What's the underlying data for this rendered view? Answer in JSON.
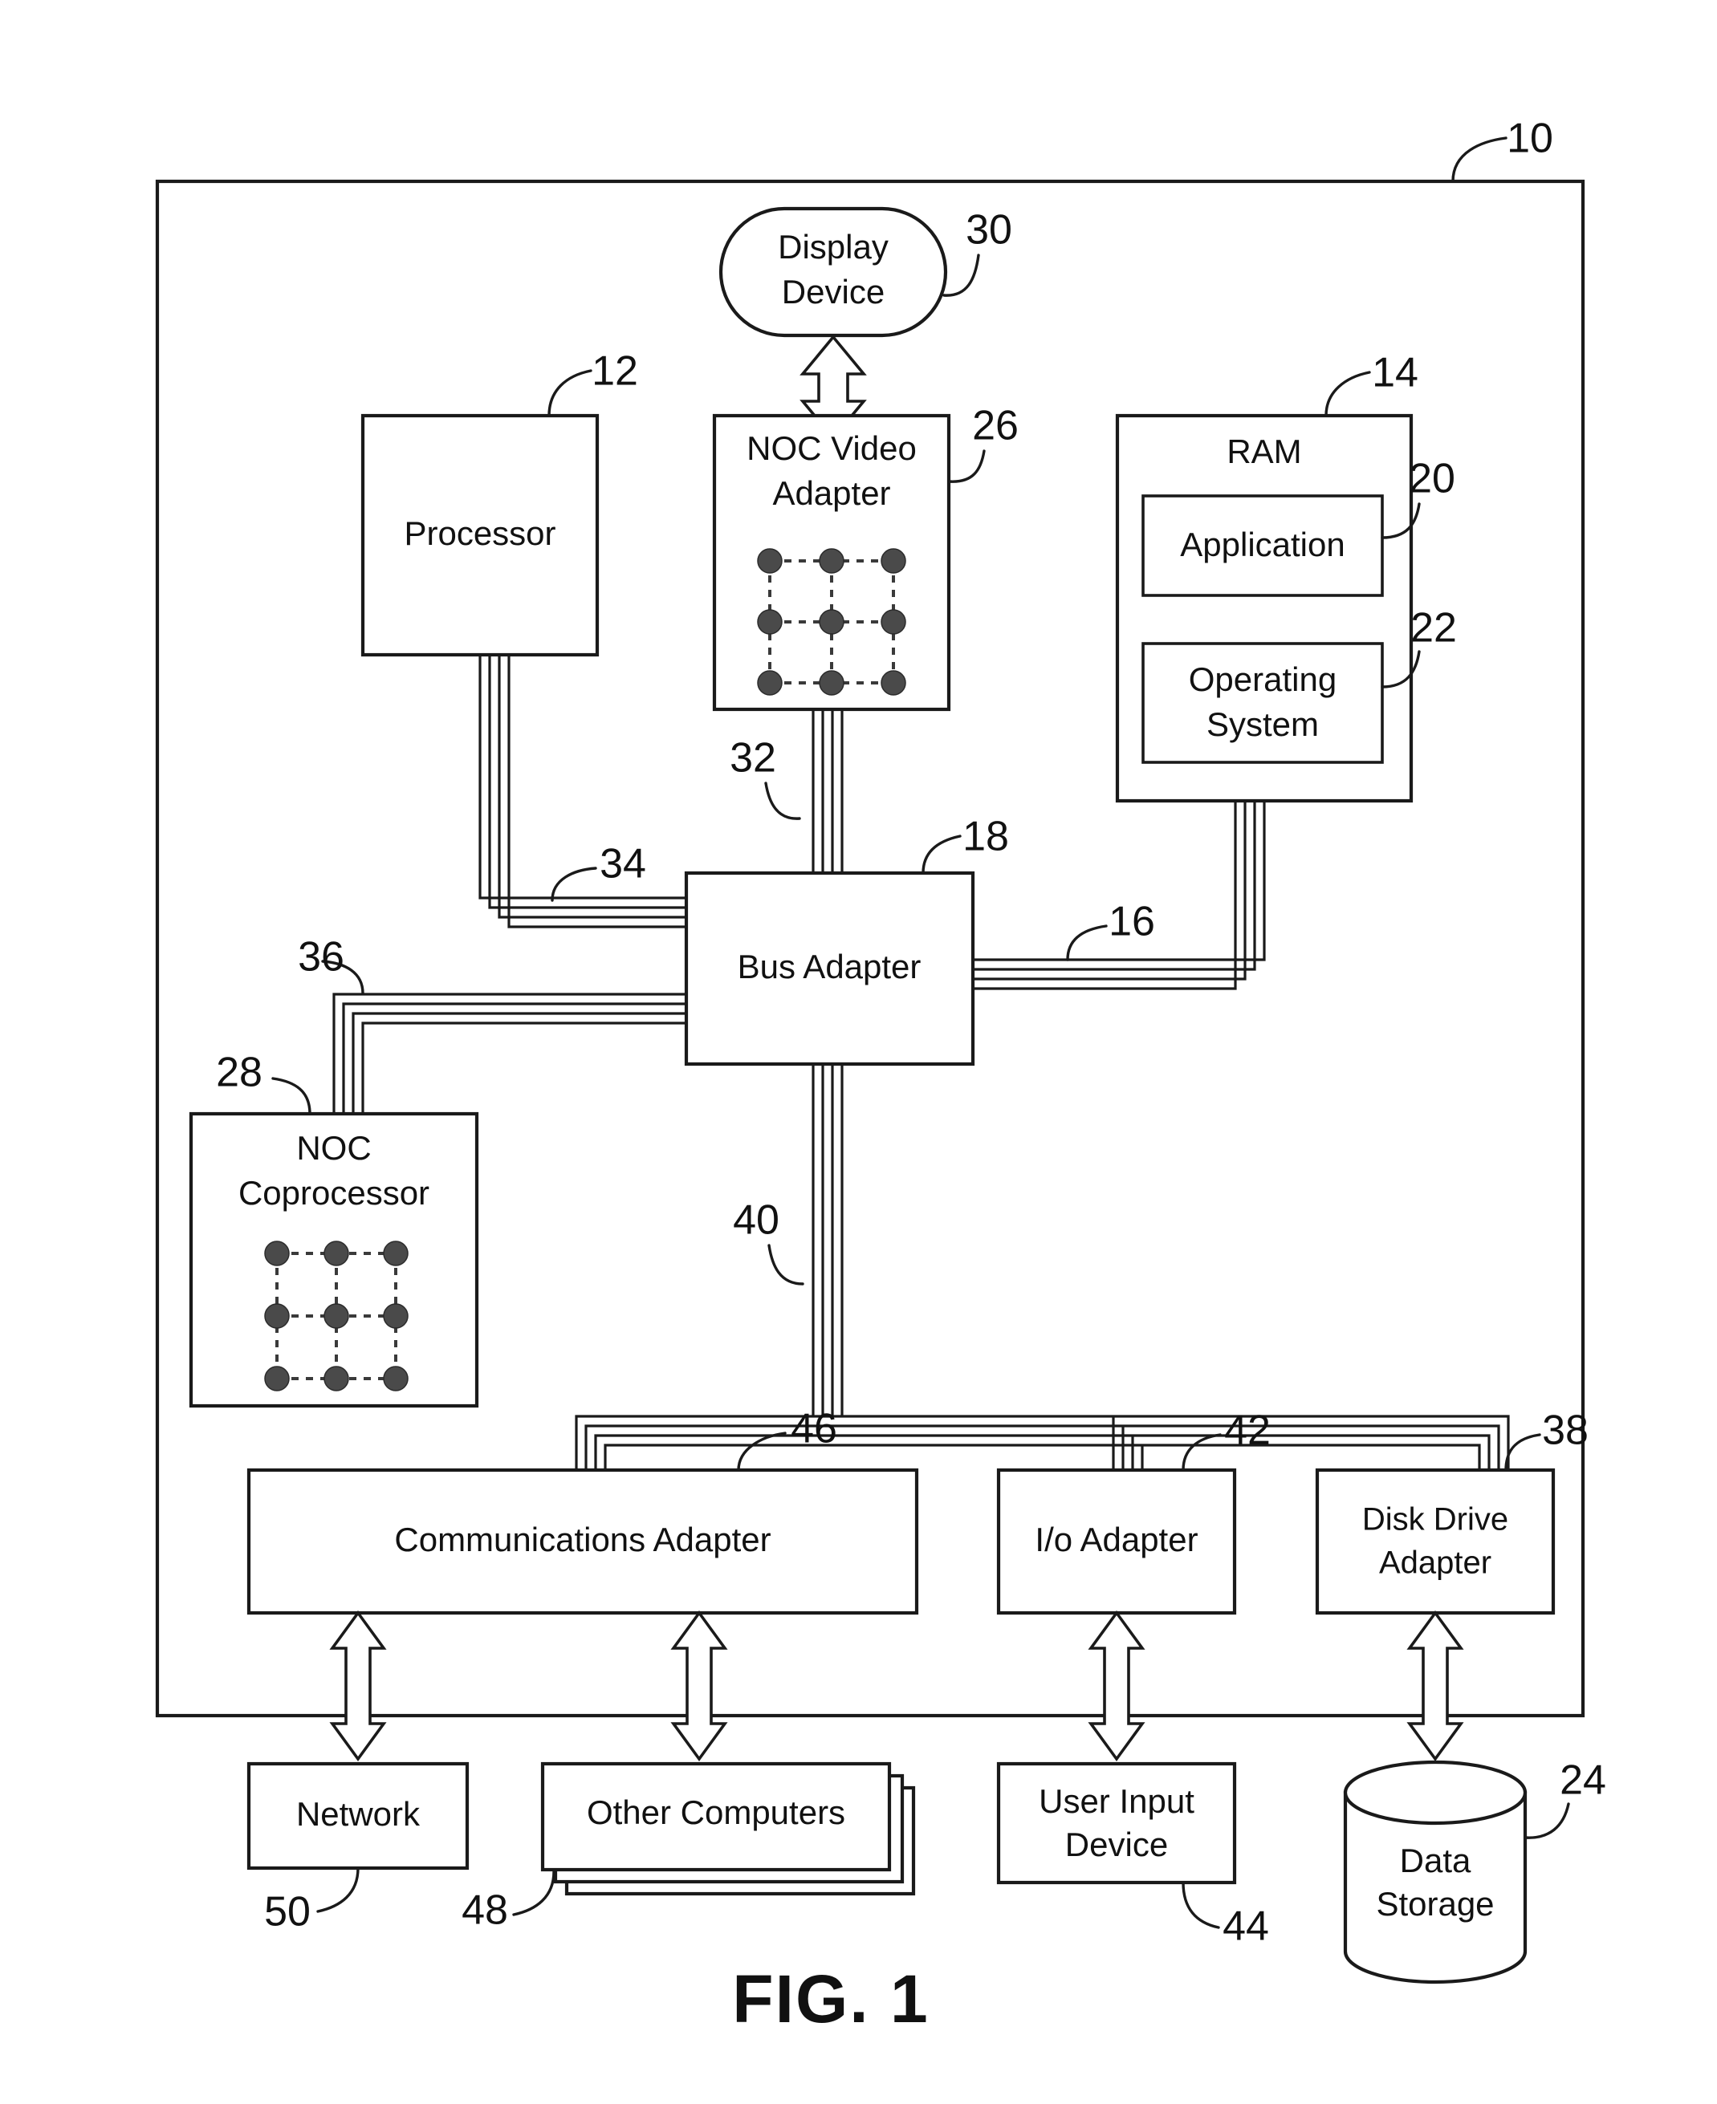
{
  "figure": {
    "caption": "FIG. 1",
    "chassis_ref": "10"
  },
  "nodes": {
    "display_device": {
      "label_line1": "Display",
      "label_line2": "Device",
      "ref": "30"
    },
    "processor": {
      "label_line1": "Processor",
      "ref": "12"
    },
    "noc_video_adapter": {
      "label_line1": "NOC Video",
      "label_line2": "Adapter",
      "ref": "26"
    },
    "ram": {
      "label_line1": "RAM",
      "ref": "14"
    },
    "application": {
      "label_line1": "Application",
      "ref": "20"
    },
    "operating_system": {
      "label_line1": "Operating",
      "label_line2": "System",
      "ref": "22"
    },
    "bus_adapter": {
      "label_line1": "Bus Adapter",
      "ref": "18"
    },
    "noc_coprocessor": {
      "label_line1": "NOC",
      "label_line2": "Coprocessor",
      "ref": "28"
    },
    "communications_adapter": {
      "label_line1": "Communications Adapter",
      "ref": "46"
    },
    "io_adapter": {
      "label_line1": "I/o Adapter",
      "ref": "42"
    },
    "disk_drive_adapter": {
      "label_line1": "Disk Drive",
      "label_line2": "Adapter",
      "ref": "38"
    },
    "network": {
      "label_line1": "Network",
      "ref": "50"
    },
    "other_computers": {
      "label_line1": "Other Computers",
      "ref": "48"
    },
    "user_input_device": {
      "label_line1": "User Input",
      "label_line2": "Device",
      "ref": "44"
    },
    "data_storage": {
      "label_line1": "Data",
      "label_line2": "Storage",
      "ref": "24"
    }
  },
  "bus_refs": {
    "front_side_bus_ram": "16",
    "video_bus": "32",
    "front_side_bus_processor": "34",
    "coprocessor_bus": "36",
    "expansion_bus": "40"
  },
  "colors": {
    "ink": "#1a1a1a",
    "paper": "#ffffff",
    "mesh_dot": "#4a4a4a"
  },
  "mesh": {
    "rows": 3,
    "cols": 3,
    "dot_count": 9,
    "link_style": "dashed"
  }
}
